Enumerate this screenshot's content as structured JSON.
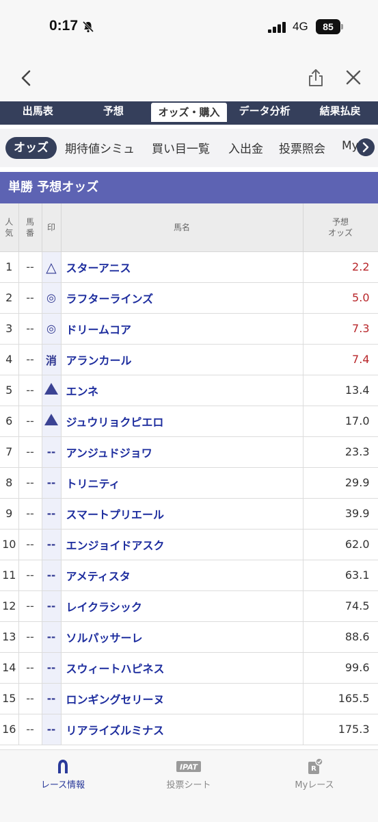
{
  "status_bar": {
    "time": "0:17",
    "network": "4G",
    "battery": "85"
  },
  "main_tabs": [
    {
      "label": "出馬表"
    },
    {
      "label": "予想"
    },
    {
      "label": "オッズ・購入"
    },
    {
      "label": "データ分析"
    },
    {
      "label": "結果払戻"
    }
  ],
  "sub_tabs": [
    {
      "label": "オッズ"
    },
    {
      "label": "期待値シミュ"
    },
    {
      "label": "買い目一覧"
    },
    {
      "label": "入出金"
    },
    {
      "label": "投票照会"
    },
    {
      "label": "My"
    }
  ],
  "section_title": "単勝 予想オッズ",
  "table": {
    "headers": {
      "popularity": "人\n気",
      "number": "馬\n番",
      "mark": "印",
      "name": "馬名",
      "odds": "予想\nオッズ"
    },
    "rows": [
      {
        "pop": "1",
        "num": "--",
        "mark": "△",
        "name": "スターアニス",
        "odds": "2.2"
      },
      {
        "pop": "2",
        "num": "--",
        "mark": "◎",
        "name": "ラフターラインズ",
        "odds": "5.0"
      },
      {
        "pop": "3",
        "num": "--",
        "mark": "◎",
        "name": "ドリームコア",
        "odds": "7.3"
      },
      {
        "pop": "4",
        "num": "--",
        "mark": "消",
        "name": "アランカール",
        "odds": "7.4"
      },
      {
        "pop": "5",
        "num": "--",
        "mark": "▲",
        "name": "エンネ",
        "odds": "13.4"
      },
      {
        "pop": "6",
        "num": "--",
        "mark": "▲",
        "name": "ジュウリョクピエロ",
        "odds": "17.0"
      },
      {
        "pop": "7",
        "num": "--",
        "mark": "--",
        "name": "アンジュドジョワ",
        "odds": "23.3"
      },
      {
        "pop": "8",
        "num": "--",
        "mark": "--",
        "name": "トリニティ",
        "odds": "29.9"
      },
      {
        "pop": "9",
        "num": "--",
        "mark": "--",
        "name": "スマートプリエール",
        "odds": "39.9"
      },
      {
        "pop": "10",
        "num": "--",
        "mark": "--",
        "name": "エンジョイドアスク",
        "odds": "62.0"
      },
      {
        "pop": "11",
        "num": "--",
        "mark": "--",
        "name": "アメティスタ",
        "odds": "63.1"
      },
      {
        "pop": "12",
        "num": "--",
        "mark": "--",
        "name": "レイクラシック",
        "odds": "74.5"
      },
      {
        "pop": "13",
        "num": "--",
        "mark": "--",
        "name": "ソルパッサーレ",
        "odds": "88.6"
      },
      {
        "pop": "14",
        "num": "--",
        "mark": "--",
        "name": "スウィートハピネス",
        "odds": "99.6"
      },
      {
        "pop": "15",
        "num": "--",
        "mark": "--",
        "name": "ロンギングセリーヌ",
        "odds": "165.5"
      },
      {
        "pop": "16",
        "num": "--",
        "mark": "--",
        "name": "リアライズルミナス",
        "odds": "175.3"
      }
    ]
  },
  "bottom_nav": [
    {
      "label": "レース情報",
      "icon": "horseshoe-icon",
      "badge": ""
    },
    {
      "label": "投票シート",
      "icon": "ipat-icon",
      "badge": "IPAT"
    },
    {
      "label": "Myレース",
      "icon": "my-race-icon",
      "badge": "R"
    }
  ],
  "colors": {
    "nav_dark": "#353f5b",
    "section_header": "#5d63b3",
    "horse_name": "#1d2d9e",
    "odds_low": "#b8262a",
    "active_bottom": "#2a3a9a"
  }
}
